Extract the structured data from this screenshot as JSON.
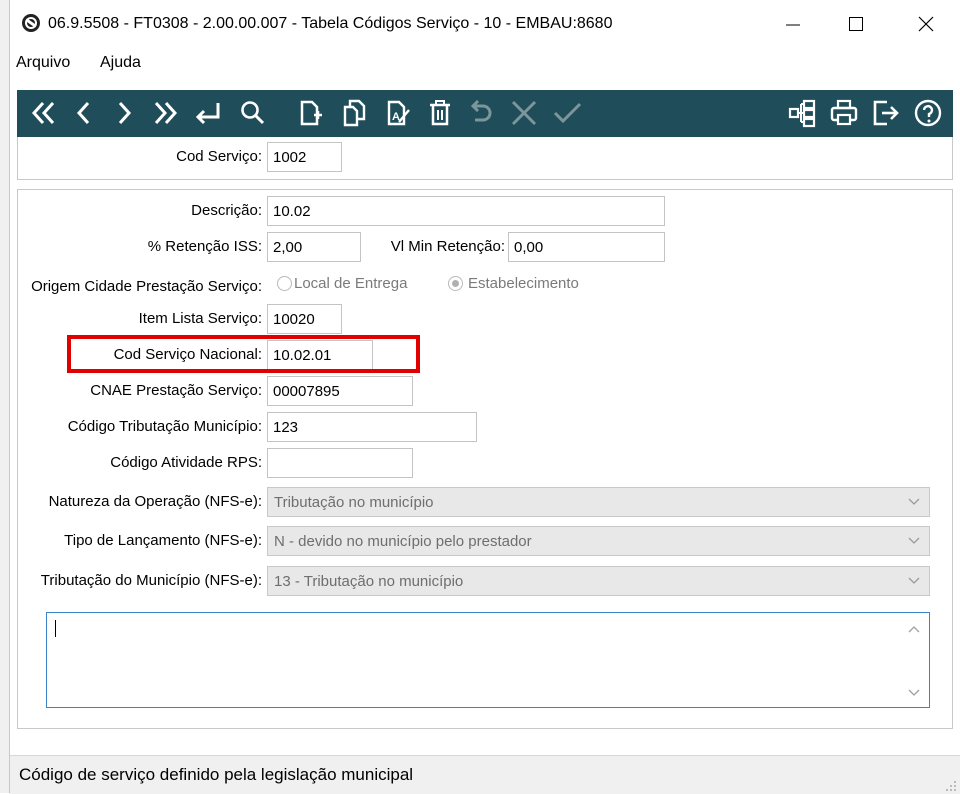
{
  "window": {
    "title": "06.9.5508 - FT0308 - 2.00.00.007 - Tabela Códigos Serviço - 10 - EMBAU:8680",
    "minimize_glyph": "—",
    "maximize_glyph": "☐",
    "close_glyph": "✕"
  },
  "menu": {
    "items": [
      "Arquivo",
      "Ajuda"
    ]
  },
  "toolbar": {
    "icons": [
      "first-icon",
      "previous-icon",
      "next-icon",
      "last-icon",
      "return-icon",
      "search-icon",
      "new-icon",
      "copy-icon",
      "edit-icon",
      "delete-icon",
      "undo-icon",
      "cancel-icon",
      "confirm-icon",
      "relations-icon",
      "print-icon",
      "exit-icon",
      "help-icon"
    ],
    "accent": "#1f4e5a"
  },
  "form": {
    "cod_servico": {
      "label": "Cod Serviço:",
      "value": "1002"
    },
    "descricao": {
      "label": "Descrição:",
      "value": "10.02"
    },
    "retencao_iss": {
      "label": "% Retenção ISS:",
      "value": "2,00"
    },
    "vl_min_retencao": {
      "label": "Vl Min Retenção:",
      "value": "0,00"
    },
    "origem_cidade": {
      "label": "Origem Cidade Prestação Serviço:",
      "options": [
        "Local de Entrega",
        "Estabelecimento"
      ],
      "selected": "Estabelecimento"
    },
    "item_lista": {
      "label": "Item Lista Serviço:",
      "value": "10020"
    },
    "cod_servico_nacional": {
      "label": "Cod Serviço Nacional:",
      "value": "10.02.01"
    },
    "cnae": {
      "label": "CNAE Prestação Serviço:",
      "value": "00007895"
    },
    "codigo_tributacao": {
      "label": "Código Tributação Município:",
      "value": "123"
    },
    "codigo_atividade": {
      "label": "Código Atividade RPS:",
      "value": ""
    },
    "natureza_operacao": {
      "label": "Natureza da Operação (NFS-e):",
      "value": "Tributação no município"
    },
    "tipo_lancamento": {
      "label": "Tipo de Lançamento (NFS-e):",
      "value": "N - devido no município pelo prestador"
    },
    "tributacao_municipio": {
      "label": "Tributação do Município (NFS-e):",
      "value": "13 - Tributação no município"
    }
  },
  "status": {
    "text": "Código de serviço definido pela legislação municipal"
  },
  "colors": {
    "highlight": "#e00000",
    "focus_border": "#3a82c6"
  }
}
